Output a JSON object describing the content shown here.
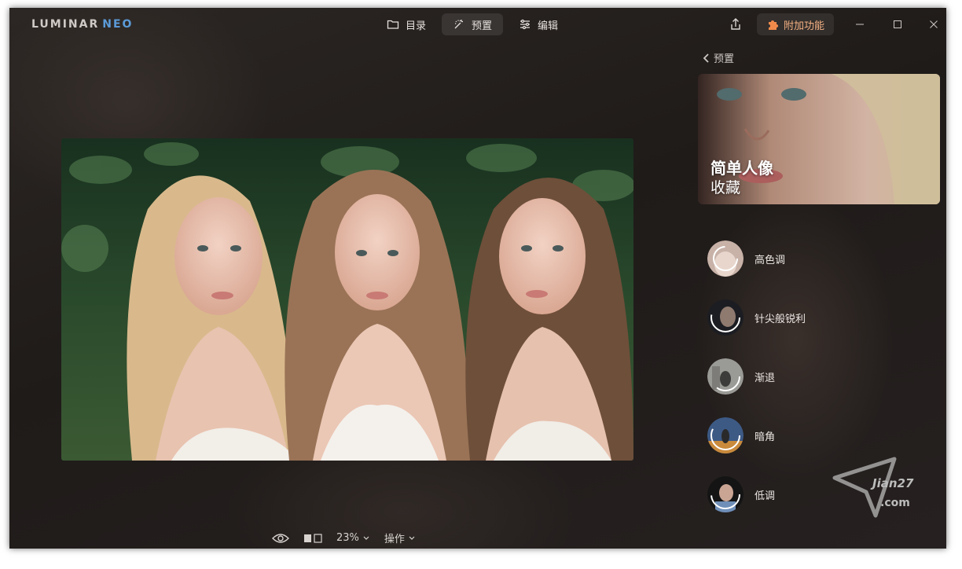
{
  "app": {
    "logo_part1": "LUMINAR",
    "logo_part2": "NEO",
    "accent_color": "#5b9bd9",
    "addon_color": "#f4b183"
  },
  "nav": {
    "tabs": [
      {
        "label": "目录",
        "icon": "folder-icon",
        "active": false
      },
      {
        "label": "预置",
        "icon": "magic-wand-icon",
        "active": true
      },
      {
        "label": "编辑",
        "icon": "sliders-icon",
        "active": false
      }
    ]
  },
  "header": {
    "share_icon": "share-icon",
    "addons_label": "附加功能",
    "addons_icon": "puzzle-icon",
    "window_controls": [
      "minimize-icon",
      "maximize-icon",
      "close-icon"
    ]
  },
  "bottom": {
    "eye_icon": "eye-icon",
    "compare_icon": "compare-icon",
    "zoom": "23%",
    "actions": "操作"
  },
  "panel": {
    "back_label": "预置",
    "featured": {
      "title": "简单人像",
      "subtitle": "收藏"
    },
    "presets": [
      {
        "label": "高色调"
      },
      {
        "label": "针尖般锐利"
      },
      {
        "label": "渐退"
      },
      {
        "label": "暗角"
      },
      {
        "label": "低调"
      }
    ]
  },
  "watermark": {
    "line1": "Jian27",
    "line2": ".com"
  }
}
